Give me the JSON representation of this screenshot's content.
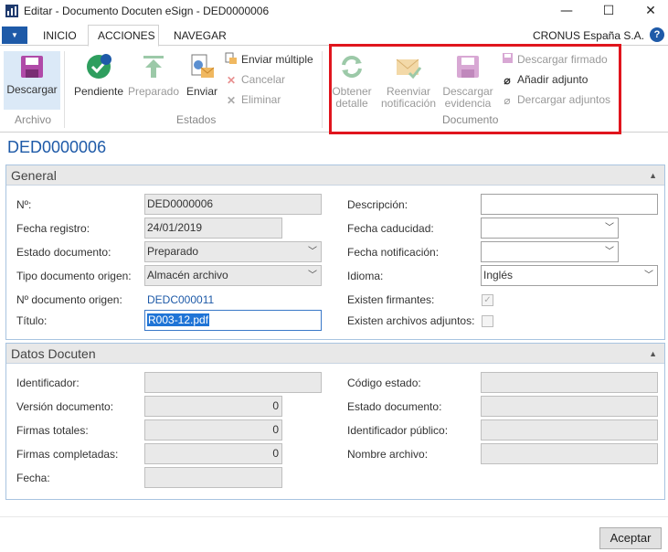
{
  "window": {
    "title": "Editar - Documento Docuten eSign - DED0000006",
    "minimize": "—",
    "maximize": "☐",
    "close": "✕"
  },
  "menu": {
    "file_glyph": "▼",
    "tabs": [
      "INICIO",
      "ACCIONES",
      "NAVEGAR"
    ],
    "active_tab": "ACCIONES",
    "company": "CRONUS España S.A.",
    "help": "?"
  },
  "ribbon": {
    "archivo": {
      "group": "Archivo",
      "descargar": "Descargar"
    },
    "estados": {
      "group": "Estados",
      "pendiente": "Pendiente",
      "preparado": "Preparado",
      "enviar": "Enviar",
      "enviar_multiple": "Enviar múltiple",
      "cancelar": "Cancelar",
      "eliminar": "Eliminar"
    },
    "documento": {
      "group": "Documento",
      "obtener_1": "Obtener",
      "obtener_2": "detalle",
      "reenviar_1": "Reenviar",
      "reenviar_2": "notificación",
      "evidencia_1": "Descargar",
      "evidencia_2": "evidencia",
      "descargar_firmado": "Descargar firmado",
      "anadir_adjunto": "Añadir adjunto",
      "descargar_adjuntos": "Dercargar adjuntos"
    },
    "colors": {
      "blue": "#1e5aa8",
      "magenta": "#b04aa8",
      "green": "#2e9e5e",
      "orange": "#e08a2a",
      "red_highlight": "#e0151d"
    }
  },
  "page": {
    "title": "DED0000006"
  },
  "general": {
    "header": "General",
    "no_label": "Nº:",
    "no_value": "DED0000006",
    "fecha_registro_label": "Fecha registro:",
    "fecha_registro_value": "24/01/2019",
    "estado_label": "Estado documento:",
    "estado_value": "Preparado",
    "tipo_origen_label": "Tipo documento origen:",
    "tipo_origen_value": "Almacén archivo",
    "no_origen_label": "Nº documento origen:",
    "no_origen_value": "DEDC000011",
    "titulo_label": "Título:",
    "titulo_value": "R003-12.pdf",
    "descripcion_label": "Descripción:",
    "descripcion_value": "",
    "caducidad_label": "Fecha caducidad:",
    "caducidad_value": "",
    "notificacion_label": "Fecha notificación:",
    "notificacion_value": "",
    "idioma_label": "Idioma:",
    "idioma_value": "Inglés",
    "firmantes_label": "Existen firmantes:",
    "firmantes_checked": true,
    "adjuntos_label": "Existen archivos adjuntos:",
    "adjuntos_checked": false
  },
  "datos": {
    "header": "Datos Docuten",
    "identificador_label": "Identificador:",
    "identificador_value": "",
    "version_label": "Versión documento:",
    "version_value": "0",
    "firmas_totales_label": "Firmas totales:",
    "firmas_totales_value": "0",
    "firmas_completadas_label": "Firmas completadas:",
    "firmas_completadas_value": "0",
    "fecha_label": "Fecha:",
    "fecha_value": "",
    "codigo_estado_label": "Código estado:",
    "codigo_estado_value": "",
    "estado_documento_label": "Estado documento:",
    "estado_documento_value": "",
    "identificador_publico_label": "Identificador público:",
    "identificador_publico_value": "",
    "nombre_archivo_label": "Nombre archivo:",
    "nombre_archivo_value": ""
  },
  "footer": {
    "accept": "Aceptar"
  }
}
